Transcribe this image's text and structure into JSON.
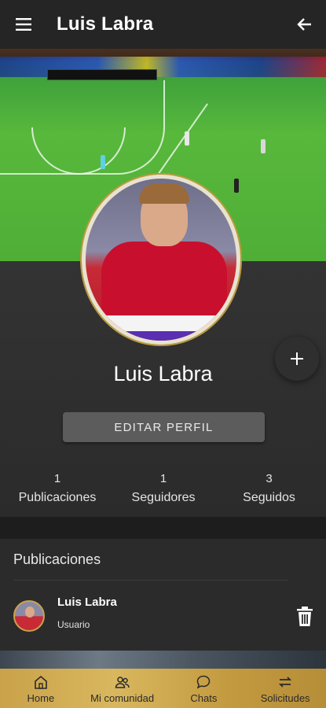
{
  "appbar": {
    "title": "Luis Labra",
    "menu_icon": "menu-icon",
    "back_icon": "arrow-back-icon"
  },
  "profile": {
    "name": "Luis Labra",
    "edit_button": "EDITAR PERFIL",
    "stats": [
      {
        "value": "1",
        "label": "Publicaciones"
      },
      {
        "value": "1",
        "label": "Seguidores"
      },
      {
        "value": "3",
        "label": "Seguidos"
      }
    ]
  },
  "publications": {
    "heading": "Publicaciones",
    "posts": [
      {
        "author": "Luis Labra",
        "role": "Usuario"
      }
    ]
  },
  "bottom_nav": [
    {
      "label": "Home",
      "icon": "home-icon"
    },
    {
      "label": "Mi comunidad",
      "icon": "community-icon"
    },
    {
      "label": "Chats",
      "icon": "chat-icon"
    },
    {
      "label": "Solicitudes",
      "icon": "swap-icon"
    }
  ],
  "colors": {
    "appbar": "#252525",
    "nav_gold": "#d9b75e",
    "background": "#2b2b2b",
    "button": "#5c5c5c"
  }
}
